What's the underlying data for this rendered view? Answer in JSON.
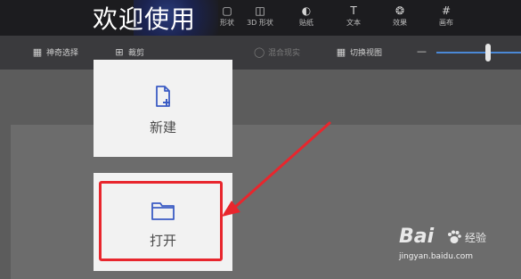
{
  "overlay": {
    "welcome_title": "欢迎使用"
  },
  "top_toolbar": {
    "tools": [
      {
        "label": "形状",
        "icon": "shapes-icon"
      },
      {
        "label": "3D 形状",
        "icon": "cube-icon"
      },
      {
        "label": "贴纸",
        "icon": "sticker-icon"
      },
      {
        "label": "文本",
        "icon": "text-icon"
      },
      {
        "label": "效果",
        "icon": "effects-icon"
      },
      {
        "label": "画布",
        "icon": "canvas-icon"
      }
    ]
  },
  "sub_toolbar": {
    "magic_select": "神奇选择",
    "crop": "裁剪",
    "mixed_reality": "混合现实",
    "switch_view": "切换视图"
  },
  "cards": {
    "new_label": "新建",
    "open_label": "打开"
  },
  "colors": {
    "accent": "#3b5cc4",
    "highlight": "#e8262d",
    "card_bg": "#f2f2f2"
  },
  "watermark": {
    "logo": "Bai",
    "logo_suffix": "经验",
    "url": "jingyan.baidu.com"
  }
}
